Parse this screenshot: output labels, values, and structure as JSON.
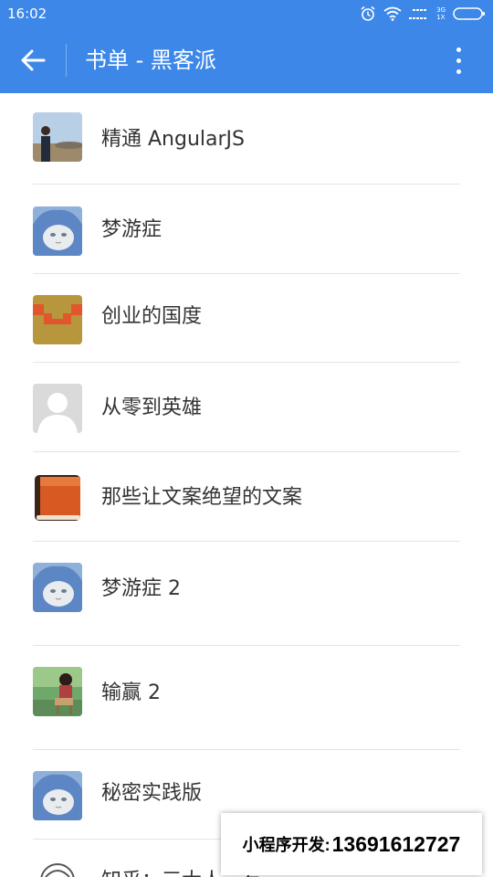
{
  "status_bar": {
    "time": "16:02",
    "network_3g": "3G",
    "network_1x": "1X"
  },
  "app_bar": {
    "title": "书单 - 黑客派",
    "back_icon": "arrow-left-icon",
    "menu_icon": "more-vertical-icon"
  },
  "colors": {
    "primary": "#3d87e8",
    "text": "#333333",
    "divider": "#e4e4e4"
  },
  "books": [
    {
      "title": "精通 AngularJS",
      "avatar": "photo-man-outdoors"
    },
    {
      "title": "梦游症",
      "avatar": "cat-in-hood"
    },
    {
      "title": "创业的国度",
      "avatar": "pixel-crown"
    },
    {
      "title": "从零到英雄",
      "avatar": "default-user"
    },
    {
      "title": "那些让文案绝望的文案",
      "avatar": "orange-book"
    },
    {
      "title": "梦游症 2",
      "avatar": "cat-in-hood"
    },
    {
      "title": "输赢 2",
      "avatar": "photo-woman-sitting"
    },
    {
      "title": "秘密实践版",
      "avatar": "cat-in-hood"
    },
    {
      "title": "知乎：三大人…有",
      "avatar": "outline-sketch"
    }
  ],
  "watermark": {
    "prefix": "小程序开发:",
    "phone": "13691612727"
  }
}
